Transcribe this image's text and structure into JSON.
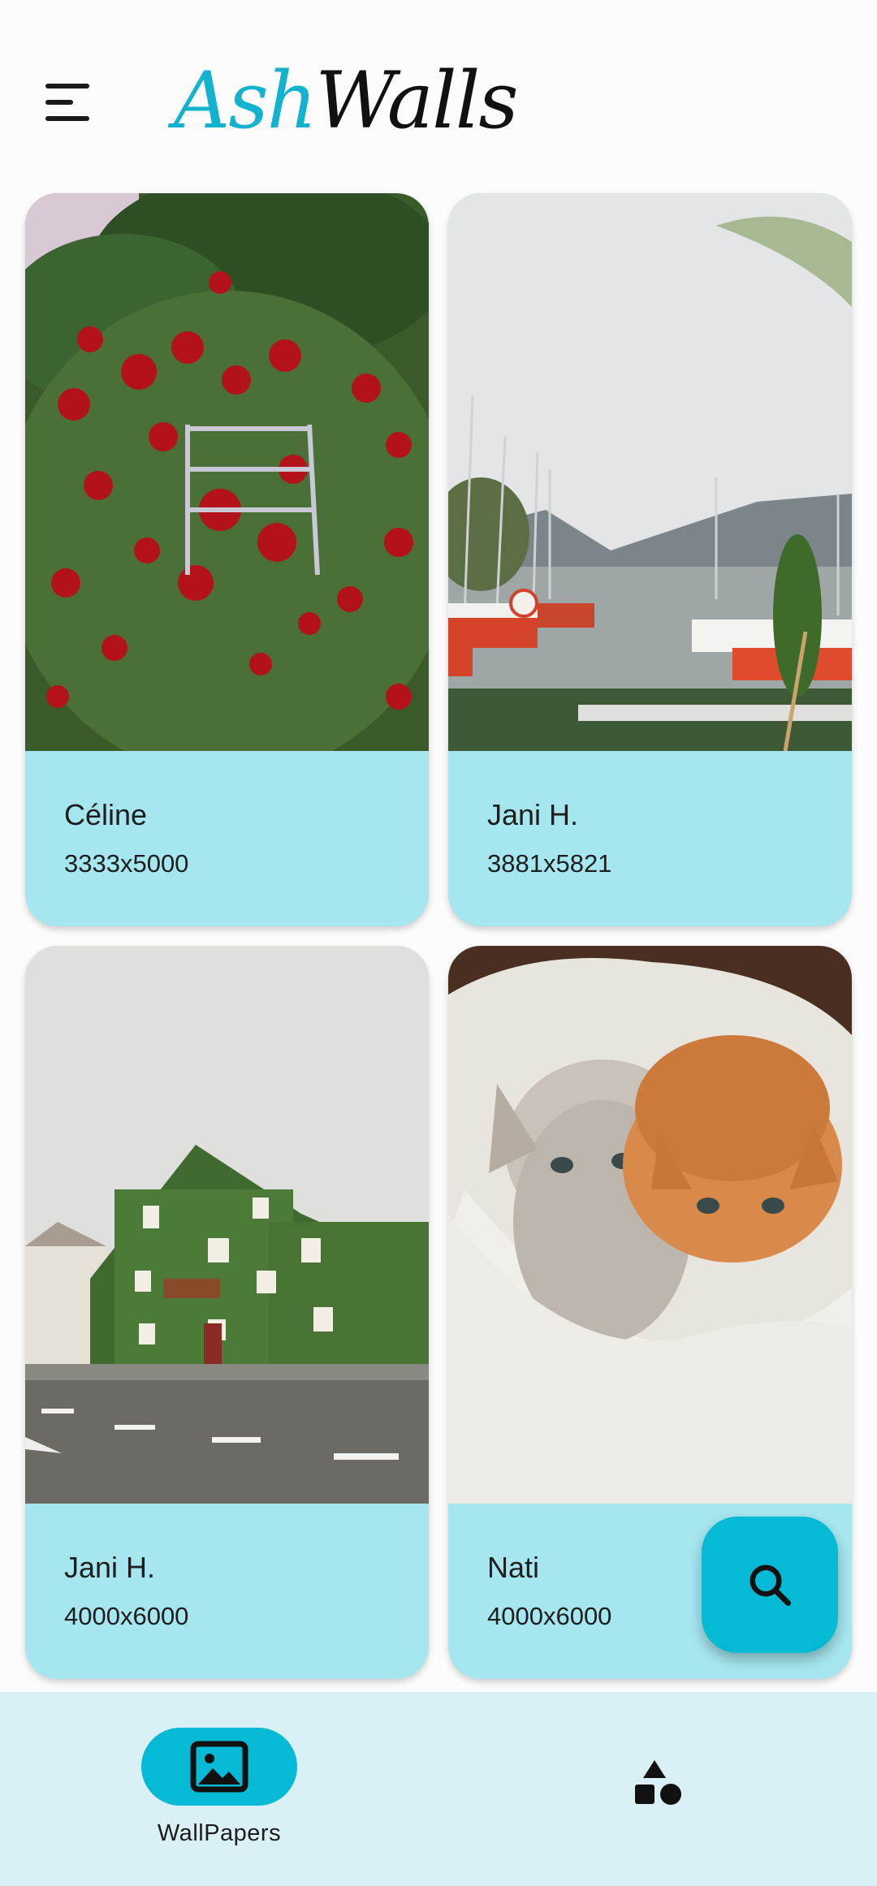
{
  "app": {
    "logo_part1": "Ash",
    "logo_part2": "Walls",
    "accent_color": "#06b9d4",
    "card_color": "#a6e6ef"
  },
  "wallpapers": [
    {
      "author": "Céline",
      "dims": "3333x5000",
      "subject": "red-roses"
    },
    {
      "author": "Jani H.",
      "dims": "3881x5821",
      "subject": "harbor-boats"
    },
    {
      "author": "Jani H.",
      "dims": "4000x6000",
      "subject": "ivy-house"
    },
    {
      "author": "Nati",
      "dims": "4000x6000",
      "subject": "kittens"
    }
  ],
  "fab": {
    "icon": "search-icon"
  },
  "bottom_nav": {
    "items": [
      {
        "label": "WallPapers",
        "icon": "image-icon",
        "active": true
      },
      {
        "label": "",
        "icon": "shapes-icon",
        "active": false
      }
    ]
  }
}
